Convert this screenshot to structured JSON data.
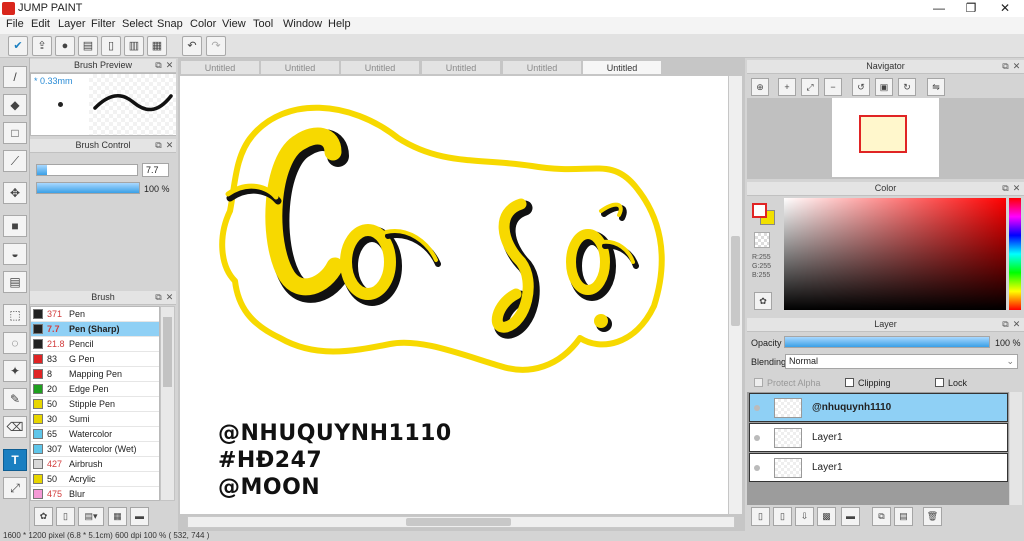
{
  "app": {
    "title": "JUMP PAINT"
  },
  "window_controls": {
    "minimize": "—",
    "maximize": "❐",
    "close": "✕"
  },
  "menu": [
    "File",
    "Edit",
    "Layer",
    "Filter",
    "Select",
    "Snap",
    "Color",
    "View",
    "Tool",
    "Window",
    "Help"
  ],
  "tabs": [
    {
      "label": "Untitled",
      "active": false
    },
    {
      "label": "Untitled",
      "active": false
    },
    {
      "label": "Untitled",
      "active": false
    },
    {
      "label": "Untitled",
      "active": false
    },
    {
      "label": "Untitled",
      "active": false
    },
    {
      "label": "Untitled",
      "active": true
    }
  ],
  "brush_preview": {
    "title": "Brush Preview",
    "size_label": "* 0.33mm"
  },
  "brush_control": {
    "title": "Brush Control",
    "size_value": "7.7",
    "size_fraction": 0.1,
    "opacity_value": "100 %",
    "opacity_fraction": 1.0
  },
  "brush": {
    "title": "Brush",
    "items": [
      {
        "size": "371",
        "name": "Pen",
        "color": "#222222",
        "size_color": "#d23c3c",
        "selected": false
      },
      {
        "size": "7.7",
        "name": "Pen (Sharp)",
        "color": "#222222",
        "size_color": "#d23c3c",
        "selected": true
      },
      {
        "size": "21.8",
        "name": "Pencil",
        "color": "#222222",
        "size_color": "#d23c3c",
        "selected": false
      },
      {
        "size": "83",
        "name": "G Pen",
        "color": "#e02424",
        "size_color": "#222222",
        "selected": false
      },
      {
        "size": "8",
        "name": "Mapping Pen",
        "color": "#e02424",
        "size_color": "#222222",
        "selected": false
      },
      {
        "size": "20",
        "name": "Edge Pen",
        "color": "#1fa01f",
        "size_color": "#222222",
        "selected": false
      },
      {
        "size": "50",
        "name": "Stipple Pen",
        "color": "#e8d600",
        "size_color": "#222222",
        "selected": false
      },
      {
        "size": "30",
        "name": "Sumi",
        "color": "#e8d600",
        "size_color": "#222222",
        "selected": false
      },
      {
        "size": "65",
        "name": "Watercolor",
        "color": "#5fc6ea",
        "size_color": "#222222",
        "selected": false
      },
      {
        "size": "307",
        "name": "Watercolor (Wet)",
        "color": "#5fc6ea",
        "size_color": "#222222",
        "selected": false
      },
      {
        "size": "427",
        "name": "Airbrush",
        "color": "#d8d8d8",
        "size_color": "#d23c3c",
        "selected": false
      },
      {
        "size": "50",
        "name": "Acrylic",
        "color": "#e8d600",
        "size_color": "#222222",
        "selected": false
      },
      {
        "size": "475",
        "name": "Blur",
        "color": "#f59ad6",
        "size_color": "#d23c3c",
        "selected": false
      }
    ]
  },
  "canvas": {
    "lettering": "Cơ sở",
    "handles": [
      "@NHUQUYNH1110",
      "#HĐ247",
      "@MOON"
    ],
    "outline_color": "#f7d900"
  },
  "navigator": {
    "title": "Navigator"
  },
  "color": {
    "title": "Color",
    "r": "R:255",
    "g": "G:255",
    "b": "B:255",
    "foreground": "#ffffff",
    "background": "#f2e000"
  },
  "layer": {
    "title": "Layer",
    "opacity_label": "Opacity",
    "opacity_value": "100 %",
    "opacity_fraction": 1.0,
    "blending_label": "Blending",
    "blending_value": "Normal",
    "protect_alpha": "Protect Alpha",
    "clipping": "Clipping",
    "lock": "Lock",
    "items": [
      {
        "name": "@nhuquynh1110",
        "selected": true
      },
      {
        "name": "Layer1",
        "selected": false
      },
      {
        "name": "Layer1",
        "selected": false
      }
    ]
  },
  "status": "1600 * 1200 pixel  (6.8 * 5.1cm)  600 dpi  100 %  ( 532, 744 )"
}
